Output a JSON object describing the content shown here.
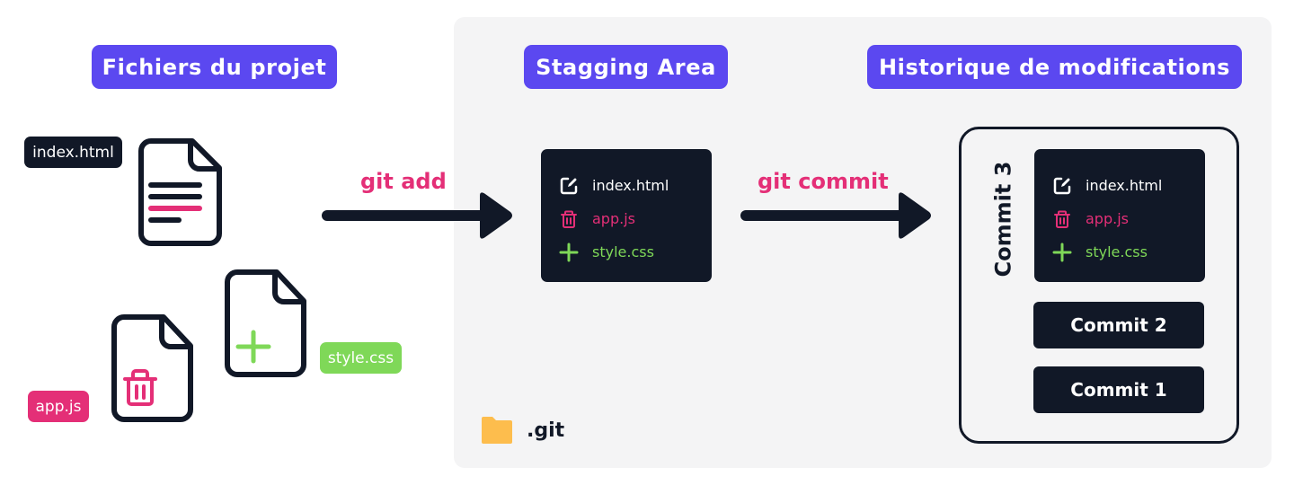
{
  "headings": {
    "files": "Fichiers du projet",
    "staging": "Stagging Area",
    "history": "Historique de modifications"
  },
  "working_files": [
    {
      "name": "index.html",
      "status": "modified",
      "icon": "document-lines-icon",
      "color": "#111827"
    },
    {
      "name": "app.js",
      "status": "deleted",
      "icon": "document-trash-icon",
      "color": "#e42f77"
    },
    {
      "name": "style.css",
      "status": "added",
      "icon": "document-plus-icon",
      "color": "#7fd858"
    }
  ],
  "commands": {
    "add": "git add",
    "commit": "git commit"
  },
  "staging_area": {
    "changes": [
      {
        "file": "index.html",
        "status": "modified",
        "icon": "edit-icon"
      },
      {
        "file": "app.js",
        "status": "deleted",
        "icon": "trash-icon"
      },
      {
        "file": "style.css",
        "status": "added",
        "icon": "plus-icon"
      }
    ]
  },
  "history": {
    "commits": [
      {
        "label": "Commit 3",
        "changes": [
          {
            "file": "index.html",
            "status": "modified",
            "icon": "edit-icon"
          },
          {
            "file": "app.js",
            "status": "deleted",
            "icon": "trash-icon"
          },
          {
            "file": "style.css",
            "status": "added",
            "icon": "plus-icon"
          }
        ]
      },
      {
        "label": "Commit 2"
      },
      {
        "label": "Commit 1"
      }
    ]
  },
  "repo_folder": {
    "name": ".git",
    "icon": "folder-icon"
  },
  "colors": {
    "accent": "#5b48f0",
    "dark": "#111827",
    "deleted": "#e42f77",
    "added": "#7fd858",
    "folder": "#fdbd4d",
    "area_bg": "#f4f4f5"
  }
}
